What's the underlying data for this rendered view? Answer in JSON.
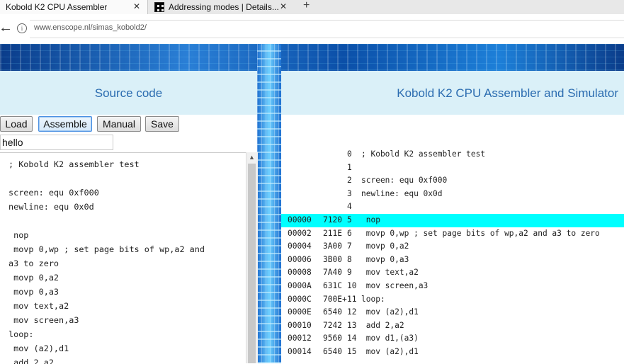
{
  "browser": {
    "tabs": [
      {
        "title": "Kobold K2 CPU Assembler",
        "active": true
      },
      {
        "title": "Addressing modes | Details...",
        "active": false
      }
    ],
    "new_tab": "+",
    "close_glyph": "✕",
    "url": "www.enscope.nl/simas_kobold2/"
  },
  "left": {
    "title": "Source code",
    "buttons": {
      "load": "Load",
      "assemble": "Assemble",
      "manual": "Manual",
      "save": "Save"
    },
    "filename": "hello",
    "source": "; Kobold K2 assembler test\n\nscreen: equ 0xf000\nnewline: equ 0x0d\n\n nop\n movp 0,wp ; set page bits of wp,a2 and\na3 to zero\n movp 0,a2\n movp 0,a3\n mov text,a2\n mov screen,a3\nloop:\n mov (a2),d1\n add 2,a2"
  },
  "right": {
    "title": "Kobold K2 CPU Assembler and Simulator",
    "listing": [
      {
        "addr": "",
        "code": "",
        "num": "0",
        "src": "; Kobold K2 assembler test"
      },
      {
        "addr": "",
        "code": "",
        "num": "1",
        "src": ""
      },
      {
        "addr": "",
        "code": "",
        "num": "2",
        "src": "screen: equ 0xf000"
      },
      {
        "addr": "",
        "code": "",
        "num": "3",
        "src": "newline: equ 0x0d"
      },
      {
        "addr": "",
        "code": "",
        "num": "4",
        "src": ""
      },
      {
        "addr": "00000",
        "code": "7120",
        "num": "5",
        "src": " nop",
        "highlight": true
      },
      {
        "addr": "00002",
        "code": "211E",
        "num": "6",
        "src": " movp 0,wp ; set page bits of wp,a2 and a3 to zero"
      },
      {
        "addr": "00004",
        "code": "3A00",
        "num": "7",
        "src": " movp 0,a2"
      },
      {
        "addr": "00006",
        "code": "3B00",
        "num": "8",
        "src": " movp 0,a3"
      },
      {
        "addr": "00008",
        "code": "7A40",
        "num": "9",
        "src": " mov text,a2"
      },
      {
        "addr": "0000A",
        "code": "631C",
        "num": "10",
        "src": " mov screen,a3"
      },
      {
        "addr": "0000C",
        "code": "700E+",
        "num": "11",
        "src": "loop:"
      },
      {
        "addr": "0000E",
        "code": "6540",
        "num": "12",
        "src": " mov (a2),d1"
      },
      {
        "addr": "00010",
        "code": "7242",
        "num": "13",
        "src": " add 2,a2"
      },
      {
        "addr": "00012",
        "code": "9560",
        "num": "14",
        "src": " mov d1,(a3)"
      },
      {
        "addr": "00014",
        "code": "6540",
        "num": "15",
        "src": " mov (a2),d1"
      }
    ]
  }
}
